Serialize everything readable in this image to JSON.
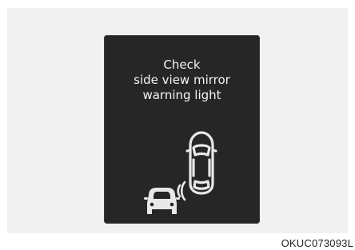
{
  "warning": {
    "line1": "Check",
    "line2": "side view mirror",
    "line3": "warning light"
  },
  "icon": {
    "name": "blind-spot-warning-icon"
  },
  "figure_code": "OKUC073093L",
  "colors": {
    "background": "#f1f1f1",
    "screen": "#262626",
    "text": "#f4f4f4",
    "icon": "#e8e8e8"
  }
}
